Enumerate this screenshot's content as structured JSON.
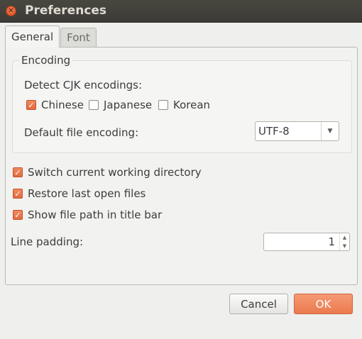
{
  "window": {
    "title": "Preferences"
  },
  "tabs": [
    {
      "label": "General",
      "active": true
    },
    {
      "label": "Font",
      "active": false
    }
  ],
  "encoding": {
    "frame_label": "Encoding",
    "detect_label": "Detect CJK encodings:",
    "cjk": [
      {
        "label": "Chinese",
        "checked": true
      },
      {
        "label": "Japanese",
        "checked": false
      },
      {
        "label": "Korean",
        "checked": false
      }
    ],
    "default_label": "Default file encoding:",
    "default_value": "UTF-8"
  },
  "options": [
    {
      "label": "Switch current working directory",
      "checked": true
    },
    {
      "label": "Restore last open files",
      "checked": true
    },
    {
      "label": "Show file path in title bar",
      "checked": true
    }
  ],
  "padding": {
    "label": "Line padding:",
    "value": "1"
  },
  "buttons": {
    "cancel": "Cancel",
    "ok": "OK"
  },
  "colors": {
    "accent": "#ec7a4f",
    "titlebar": "#3c3b37",
    "background": "#efefed"
  },
  "icons": {
    "close": "close-icon",
    "dropdown": "chevron-down-icon",
    "spin_up": "chevron-up-icon",
    "spin_down": "chevron-down-icon"
  }
}
